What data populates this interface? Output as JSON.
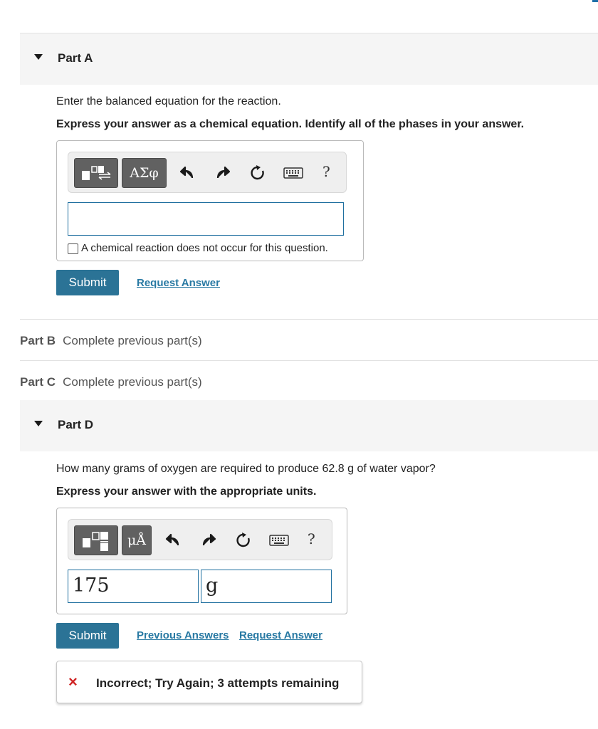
{
  "part_a": {
    "label": "Part A",
    "prompt": "Enter the balanced equation for the reaction.",
    "instruction": "Express your answer as a chemical equation. Identify all of the phases in your answer.",
    "toolbar": {
      "template_button_icon": "templates-icon",
      "symbols_button_label": "ΑΣφ",
      "help_label": "?"
    },
    "answer_value": "",
    "no_reaction_label": "A chemical reaction does not occur for this question.",
    "no_reaction_checked": false,
    "submit_label": "Submit",
    "request_answer_label": "Request Answer"
  },
  "part_b": {
    "label": "Part B",
    "status": "Complete previous part(s)"
  },
  "part_c": {
    "label": "Part C",
    "status": "Complete previous part(s)"
  },
  "part_d": {
    "label": "Part D",
    "prompt": "How many grams of oxygen are required to produce 62.8 g of water vapor?",
    "instruction": "Express your answer with the appropriate units.",
    "toolbar": {
      "template_button_icon": "fraction-template-icon",
      "units_button_label": "μÅ",
      "help_label": "?"
    },
    "value": "175",
    "units": "g",
    "submit_label": "Submit",
    "previous_answers_label": "Previous Answers",
    "request_answer_label": "Request Answer",
    "feedback": "Incorrect; Try Again; 3 attempts remaining",
    "feedback_icon": "×"
  },
  "colors": {
    "accent": "#2b7396",
    "link": "#2879a3",
    "error": "#d02626",
    "header_bg": "#f5f5f5"
  }
}
